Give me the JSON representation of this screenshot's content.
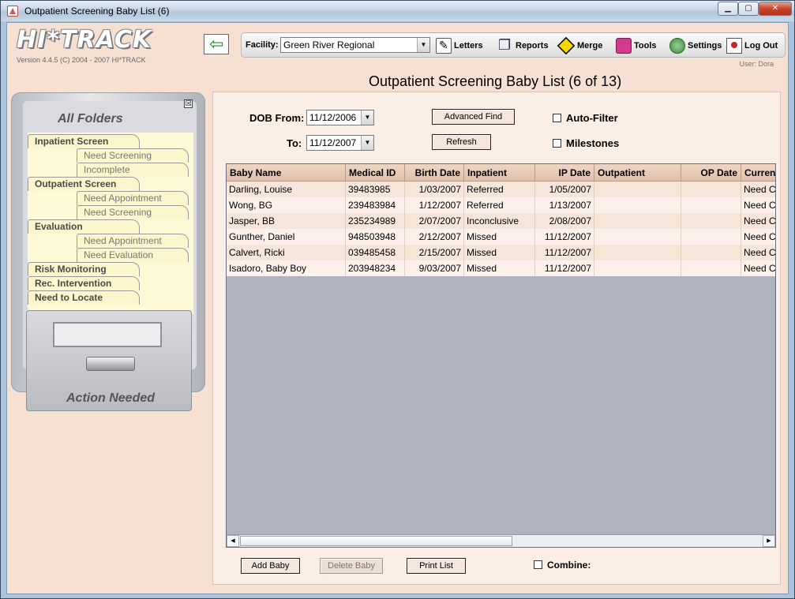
{
  "window": {
    "title": "Outpatient Screening Baby List (6)",
    "minimize": "▁",
    "maximize": "▢",
    "close": "✕"
  },
  "header": {
    "logo": "HI*TRACK",
    "version": "Version 4.4.5 (C) 2004 - 2007 HI*TRACK",
    "user": "User: Dora"
  },
  "toolbar": {
    "facility_label": "Facility:",
    "facility_value": "Green River Regional",
    "letters": "Letters",
    "reports": "Reports",
    "merge": "Merge",
    "tools": "Tools",
    "settings": "Settings",
    "logout": "Log Out"
  },
  "sidebar": {
    "close": "☒",
    "title": "All Folders",
    "folders": [
      {
        "label": "Inpatient Screen",
        "sub": [
          "Need Screening",
          "Incomplete"
        ]
      },
      {
        "label": "Outpatient Screen",
        "sub": [
          "Need Appointment",
          "Need Screening"
        ]
      },
      {
        "label": "Evaluation",
        "sub": [
          "Need Appointment",
          "Need Evaluation"
        ]
      },
      {
        "label": "Risk Monitoring",
        "sub": []
      },
      {
        "label": "Rec. Intervention",
        "sub": []
      },
      {
        "label": "Need to Locate",
        "sub": []
      }
    ],
    "drawer_label": "Action Needed"
  },
  "main": {
    "title": "Outpatient Screening Baby List (6 of 13)",
    "dob_from_label": "DOB From:",
    "dob_from": "11/12/2006",
    "to_label": "To:",
    "dob_to": "11/12/2007",
    "advanced_find": "Advanced Find",
    "refresh": "Refresh",
    "auto_filter": "Auto-Filter",
    "milestones": "Milestones",
    "add_baby": "Add Baby",
    "delete_baby": "Delete Baby",
    "print_list": "Print List",
    "combine": "Combine:"
  },
  "table": {
    "columns": [
      "Baby Name",
      "Medical ID",
      "Birth Date",
      "Inpatient",
      "IP  Date",
      "Outpatient",
      "OP  Date",
      "Curren"
    ],
    "rows": [
      [
        "Darling, Louise",
        "39483985",
        "1/03/2007",
        "Referred",
        "1/05/2007",
        "",
        "",
        "Need C"
      ],
      [
        "Wong, BG",
        "239483984",
        "1/12/2007",
        "Referred",
        "1/13/2007",
        "",
        "",
        "Need C"
      ],
      [
        "Jasper, BB",
        "235234989",
        "2/07/2007",
        "Inconclusive",
        "2/08/2007",
        "",
        "",
        "Need C"
      ],
      [
        "Gunther, Daniel",
        "948503948",
        "2/12/2007",
        "Missed",
        "11/12/2007",
        "",
        "",
        "Need C"
      ],
      [
        "Calvert, Ricki",
        "039485458",
        "2/15/2007",
        "Missed",
        "11/12/2007",
        "",
        "",
        "Need C"
      ],
      [
        "Isadoro, Baby Boy",
        "203948234",
        "9/03/2007",
        "Missed",
        "11/12/2007",
        "",
        "",
        "Need C"
      ]
    ]
  },
  "scrollbar": {
    "left": "◀",
    "right": "▶"
  },
  "dropdown_arrow": "▼"
}
